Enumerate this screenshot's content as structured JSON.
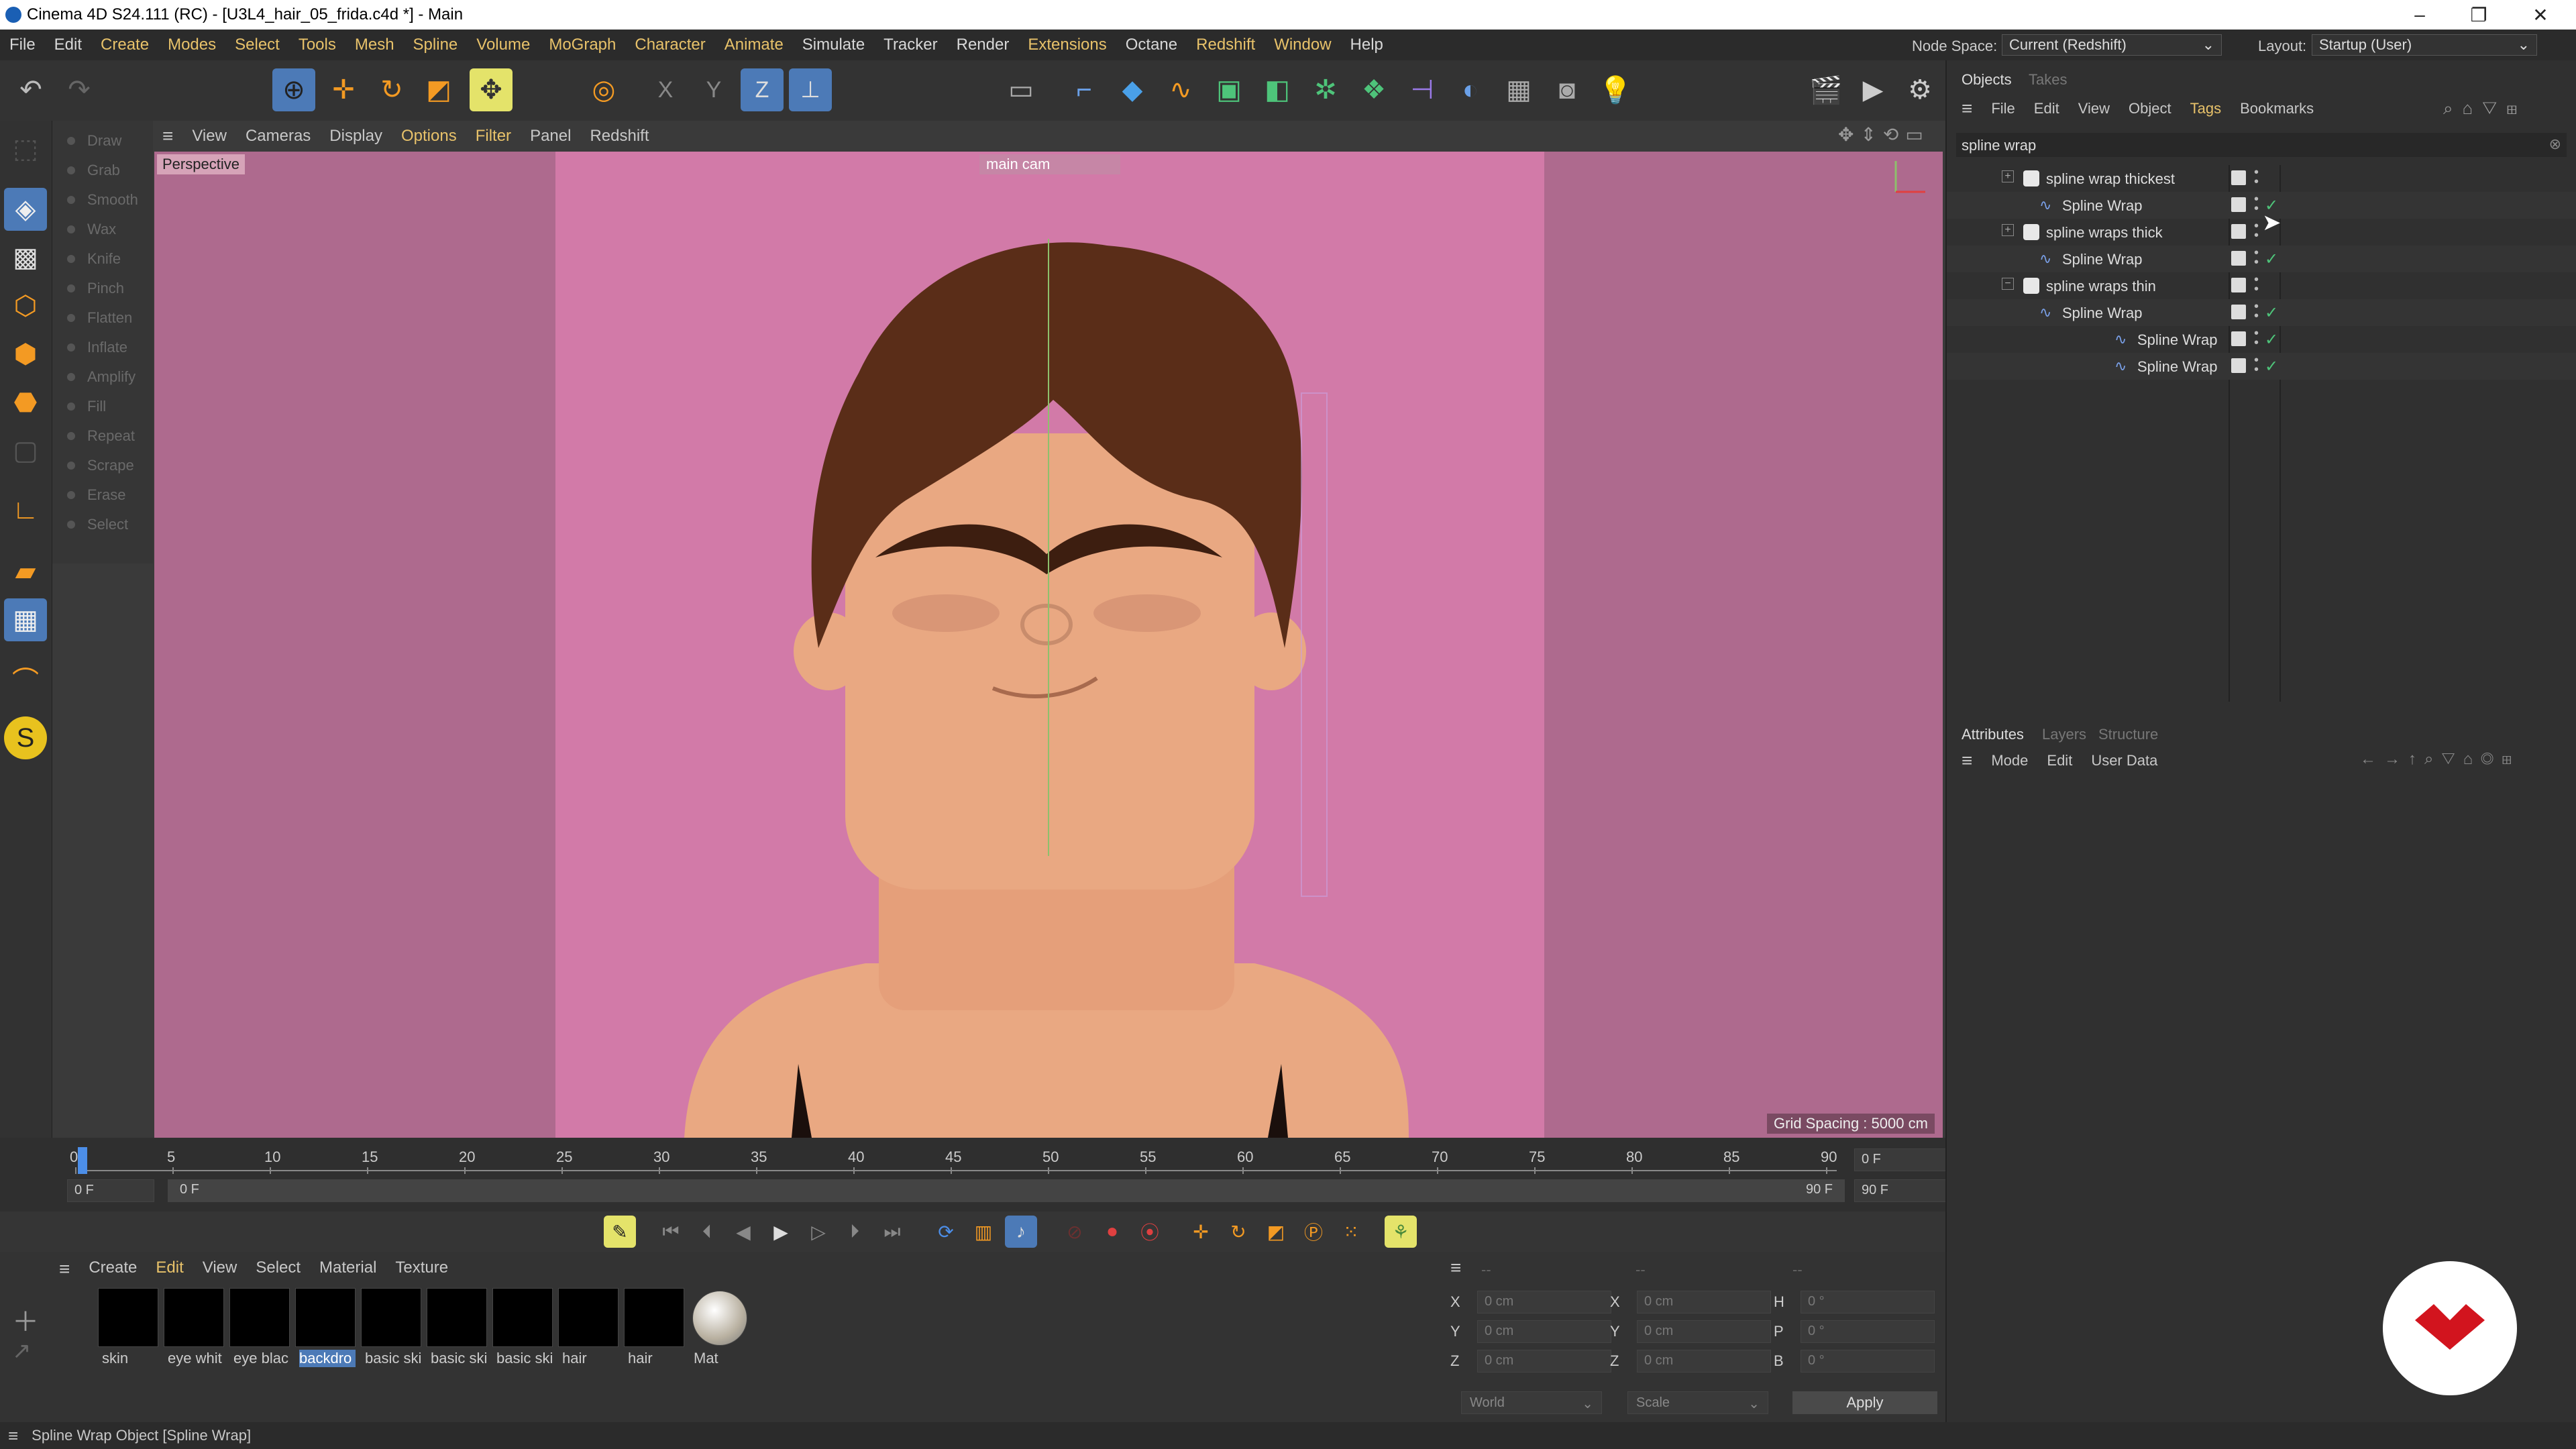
{
  "window": {
    "title": "Cinema 4D S24.111 (RC) - [U3L4_hair_05_frida.c4d *] - Main",
    "minimize": "–",
    "maximize": "❐",
    "close": "✕"
  },
  "menu": [
    "File",
    "Edit",
    "Create",
    "Modes",
    "Select",
    "Tools",
    "Mesh",
    "Spline",
    "Volume",
    "MoGraph",
    "Character",
    "Animate",
    "Simulate",
    "Tracker",
    "Render",
    "Extensions",
    "Octane",
    "Redshift",
    "Window",
    "Help"
  ],
  "menu_highlight": [
    "Create",
    "Modes",
    "Select",
    "Tools",
    "Mesh",
    "Spline",
    "Volume",
    "MoGraph",
    "Character",
    "Animate",
    "Extensions",
    "Redshift",
    "Window"
  ],
  "node_space": {
    "label": "Node Space:",
    "value": "Current (Redshift)"
  },
  "layout": {
    "label": "Layout:",
    "value": "Startup (User)"
  },
  "sculpt_tools": [
    "Draw",
    "Grab",
    "Smooth",
    "Wax",
    "Knife",
    "Pinch",
    "Flatten",
    "Inflate",
    "Amplify",
    "Fill",
    "Repeat",
    "Scrape",
    "Erase",
    "Select"
  ],
  "viewport_menu": [
    "View",
    "Cameras",
    "Display",
    "Options",
    "Filter",
    "Panel",
    "Redshift"
  ],
  "viewport_menu_highlight": [
    "Options",
    "Filter"
  ],
  "viewport": {
    "label": "Perspective",
    "camera": "main cam",
    "grid_spacing": "Grid Spacing : 5000 cm"
  },
  "timeline": {
    "ticks": [
      "0",
      "5",
      "10",
      "15",
      "20",
      "25",
      "30",
      "35",
      "40",
      "45",
      "50",
      "55",
      "60",
      "65",
      "70",
      "75",
      "80",
      "85",
      "90"
    ],
    "current_frame": "0 F",
    "end_frame": "90 F",
    "start_field": "0 F",
    "range_start": "0 F",
    "range_end": "90 F",
    "end_field": "90 F"
  },
  "material_menu": [
    "Create",
    "Edit",
    "View",
    "Select",
    "Material",
    "Texture"
  ],
  "materials": [
    "skin",
    "eye whit",
    "eye blac",
    "backdro",
    "basic ski",
    "basic ski",
    "basic ski",
    "hair",
    "hair",
    "Mat"
  ],
  "coords": {
    "header": [
      "--",
      "--",
      "--"
    ],
    "rows": [
      {
        "a": "X",
        "av": "0 cm",
        "b": "X",
        "bv": "0 cm",
        "c": "H",
        "cv": "0 °"
      },
      {
        "a": "Y",
        "av": "0 cm",
        "b": "Y",
        "bv": "0 cm",
        "c": "P",
        "cv": "0 °"
      },
      {
        "a": "Z",
        "av": "0 cm",
        "b": "Z",
        "bv": "0 cm",
        "c": "B",
        "cv": "0 °"
      }
    ],
    "space": "World",
    "mode": "Scale",
    "apply": "Apply"
  },
  "objects_panel": {
    "tabs": [
      "Objects",
      "Takes"
    ],
    "menu": [
      "File",
      "Edit",
      "View",
      "Object",
      "Tags",
      "Bookmarks"
    ],
    "search": "spline wrap",
    "tree": [
      {
        "label": "spline wrap thickest",
        "level": 0,
        "kind": "null",
        "check": false
      },
      {
        "label": "Spline Wrap",
        "level": 1,
        "kind": "wrap",
        "check": true
      },
      {
        "label": "spline wraps thick",
        "level": 0,
        "kind": "null",
        "check": false
      },
      {
        "label": "Spline Wrap",
        "level": 1,
        "kind": "wrap",
        "check": true
      },
      {
        "label": "spline wraps thin",
        "level": 0,
        "kind": "null",
        "check": false
      },
      {
        "label": "Spline Wrap",
        "level": 1,
        "kind": "wrap",
        "check": true
      },
      {
        "label": "Spline Wrap",
        "level": 2,
        "kind": "wrap",
        "check": true
      },
      {
        "label": "Spline Wrap",
        "level": 2,
        "kind": "wrap",
        "check": true
      }
    ]
  },
  "attributes_panel": {
    "tabs": [
      "Attributes",
      "Layers",
      "Structure"
    ],
    "menu": [
      "Mode",
      "Edit",
      "User Data"
    ]
  },
  "status": "Spline Wrap Object [Spline Wrap]",
  "colors": {
    "accent": "#e8c26a",
    "viewport_bg": "#ae6a8e",
    "backdrop": "#d27aa8",
    "skin": "#e9a882",
    "hair": "#5a2d18",
    "brand_red": "#d2141e"
  }
}
